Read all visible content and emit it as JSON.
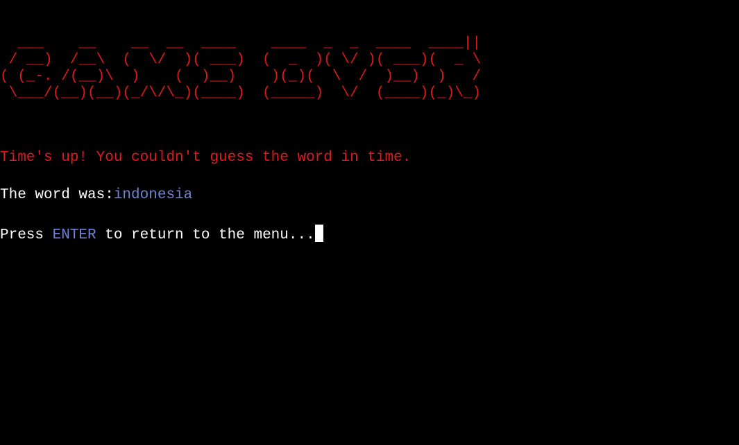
{
  "colors": {
    "background": "#000000",
    "banner": "#e0191c",
    "error_text": "#e0191c",
    "normal_text": "#ffffff",
    "highlight_text": "#6d85d6",
    "cursor": "#ffffff"
  },
  "banner": {
    "ascii_art": "  ___    __    __  __  ____    ____  _  _  ____  ____||\n / __)  /__\\  (  \\/  )( ___)  (  _  )( \\/ )( ___)(  _ \\\n( (_-. /(__)\\  )    (  )__)    )(_)(  \\  /  )__)  )   /\n \\___/(__)(__)(_/\\/\\_)(____)  (_____)  \\/  (____)(_)\\_)"
  },
  "message": {
    "time_up": "Time's up! You couldn't guess the word in time."
  },
  "reveal": {
    "label": "The word was:",
    "word": "indonesia"
  },
  "prompt": {
    "before": "Press ",
    "key": "ENTER",
    "after": " to return to the menu..."
  }
}
